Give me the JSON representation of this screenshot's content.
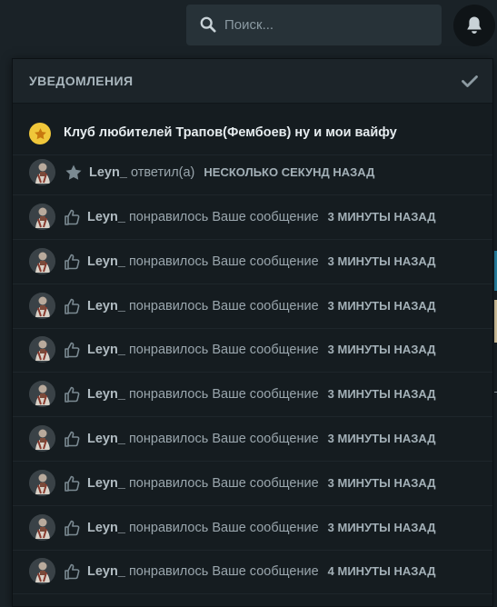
{
  "search": {
    "placeholder": "Поиск..."
  },
  "notifications": {
    "title": "УВЕДОМЛЕНИЯ",
    "club": {
      "text": "Клуб любителей Трапов(Фембоев) ну и мои вайфу"
    },
    "reply": {
      "user": "Leyn_",
      "action": "ответил(а)",
      "time": "НЕСКОЛЬКО СЕКУНД НАЗАД"
    },
    "likes": [
      {
        "user": "Leyn_",
        "action": "понравилось Ваше сообщение",
        "time": "3 МИНУТЫ НАЗАД"
      },
      {
        "user": "Leyn_",
        "action": "понравилось Ваше сообщение",
        "time": "3 МИНУТЫ НАЗАД"
      },
      {
        "user": "Leyn_",
        "action": "понравилось Ваше сообщение",
        "time": "3 МИНУТЫ НАЗАД"
      },
      {
        "user": "Leyn_",
        "action": "понравилось Ваше сообщение",
        "time": "3 МИНУТЫ НАЗАД"
      },
      {
        "user": "Leyn_",
        "action": "понравилось Ваше сообщение",
        "time": "3 МИНУТЫ НАЗАД"
      },
      {
        "user": "Leyn_",
        "action": "понравилось Ваше сообщение",
        "time": "3 МИНУТЫ НАЗАД"
      },
      {
        "user": "Leyn_",
        "action": "понравилось Ваше сообщение",
        "time": "3 МИНУТЫ НАЗАД"
      },
      {
        "user": "Leyn_",
        "action": "понравилось Ваше сообщение",
        "time": "3 МИНУТЫ НАЗАД"
      },
      {
        "user": "Leyn_",
        "action": "понравилось Ваше сообщение",
        "time": "4 МИНУТЫ НАЗАД"
      }
    ]
  },
  "icons": {
    "search": "search-icon",
    "bell": "bell-icon",
    "check": "check-icon",
    "club": "star-icon",
    "reply": "star-icon",
    "like": "thumbs-up-icon"
  },
  "colors": {
    "background": "#1a2227",
    "panel": "#151c20",
    "club_badge": "#f0c73a",
    "muted_text": "#9aa6ad"
  }
}
